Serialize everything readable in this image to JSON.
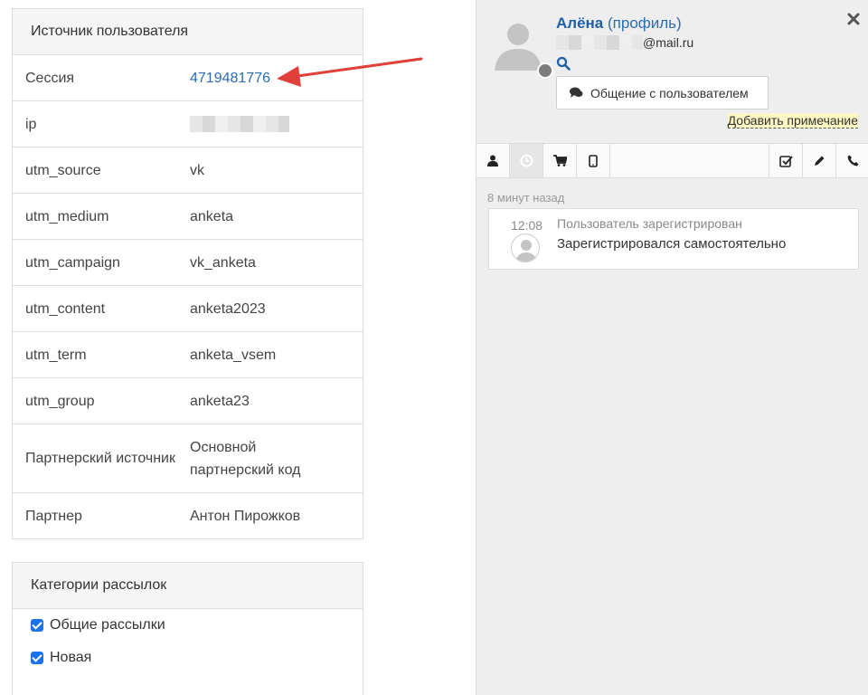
{
  "source_panel": {
    "title": "Источник пользователя",
    "rows": [
      {
        "key": "Сессия",
        "value": "4719481776"
      },
      {
        "key": "ip",
        "value": ""
      },
      {
        "key": "utm_source",
        "value": "vk"
      },
      {
        "key": "utm_medium",
        "value": "anketa"
      },
      {
        "key": "utm_campaign",
        "value": "vk_anketa"
      },
      {
        "key": "utm_content",
        "value": "anketa2023"
      },
      {
        "key": "utm_term",
        "value": "anketa_vsem"
      },
      {
        "key": "utm_group",
        "value": "anketa23"
      },
      {
        "key": "Партнерский источник",
        "value": "Основной партнерский код"
      },
      {
        "key": "Партнер",
        "value": "Антон Пирожков"
      }
    ]
  },
  "categories_panel": {
    "title": "Категории рассылок",
    "items": [
      {
        "label": "Общие рассылки",
        "checked": true
      },
      {
        "label": "Новая",
        "checked": true
      }
    ]
  },
  "user_card": {
    "name": "Алёна",
    "profile_link": "(профиль)",
    "email_suffix": "@mail.ru",
    "chat_button": "Общение с пользователем",
    "add_note": "Добавить примечание"
  },
  "timeline": {
    "time_ago": "8 минут назад",
    "events": [
      {
        "time": "12:08",
        "title": "Пользователь зарегистрирован",
        "text": "Зарегистрировался самостоятельно"
      }
    ]
  },
  "colors": {
    "accent": "#2a6db5",
    "annotation_arrow": "#e0403a"
  }
}
